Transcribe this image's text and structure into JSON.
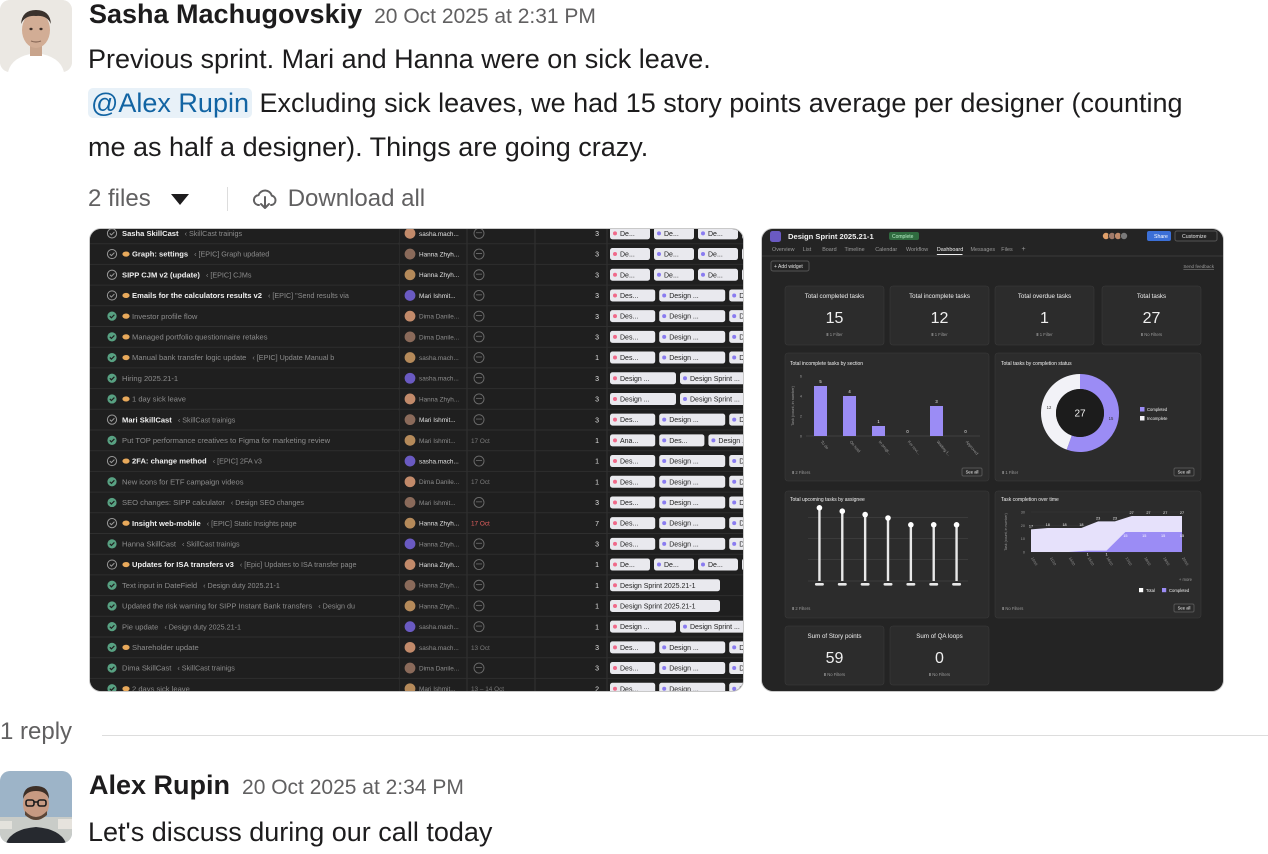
{
  "message1": {
    "author": "Sasha Machugovskiy",
    "timestamp": "20 Oct 2025 at 2:31 PM",
    "line1": "Previous sprint. Mari and Hanna were on sick leave.",
    "mention": "@Alex Rupin",
    "line2_rest": "Excluding sick leaves, we had 15 story points average per designer (counting",
    "line3": "me as half a designer). Things are going crazy."
  },
  "files": {
    "count_label": "2 files",
    "download_label": "Download all"
  },
  "task_list": {
    "rows": [
      {
        "done": false,
        "emoji": false,
        "name": "Sasha SkillCast",
        "parent": "‹ SkillCast trainigs",
        "assignee": "sasha.mach...",
        "due": "",
        "points": "3",
        "tags": [
          "De...",
          "De...",
          "De...",
          "De"
        ],
        "faded": false
      },
      {
        "done": false,
        "emoji": true,
        "name": "Graph: settings",
        "parent": "‹ [EPIC] Graph updated",
        "assignee": "Hanna Zhyh...",
        "due": "",
        "points": "3",
        "tags": [
          "De...",
          "De...",
          "De...",
          "De"
        ],
        "faded": false
      },
      {
        "done": false,
        "emoji": false,
        "name": "SIPP CJM v2 (update)",
        "parent": "‹ [EPIC] CJMs",
        "assignee": "Hanna Zhyh...",
        "due": "",
        "points": "3",
        "tags": [
          "De...",
          "De...",
          "De...",
          "De"
        ],
        "faded": false
      },
      {
        "done": false,
        "emoji": true,
        "name": "Emails for the calculators results v2",
        "parent": "‹ [EPIC] \"Send results via",
        "assignee": "Mari Ishmit...",
        "due": "",
        "points": "3",
        "tags": [
          "Des...",
          "Design ...",
          "De..."
        ],
        "faded": false
      },
      {
        "done": true,
        "emoji": true,
        "name": "Investor profile flow",
        "parent": "",
        "assignee": "Dima Danile...",
        "due": "",
        "points": "3",
        "tags": [
          "Des...",
          "Design ...",
          "De..."
        ],
        "faded": true
      },
      {
        "done": true,
        "emoji": true,
        "name": "Managed portfolio questionnaire retakes",
        "parent": "",
        "assignee": "Dima Danile...",
        "due": "",
        "points": "3",
        "tags": [
          "Des...",
          "Design ...",
          "De..."
        ],
        "faded": true
      },
      {
        "done": true,
        "emoji": true,
        "name": "Manual bank transfer logic update",
        "parent": "‹ [EPIC] Update Manual b",
        "assignee": "sasha.mach...",
        "due": "",
        "points": "1",
        "tags": [
          "Des...",
          "Design ...",
          "De..."
        ],
        "faded": true
      },
      {
        "done": true,
        "emoji": false,
        "name": "Hiring 2025.21-1",
        "parent": "",
        "assignee": "sasha.mach...",
        "due": "",
        "points": "3",
        "tags": [
          "Design ...",
          "Design Sprint ..."
        ],
        "faded": true
      },
      {
        "done": true,
        "emoji": true,
        "name": "1 day sick leave",
        "parent": "",
        "assignee": "Hanna Zhyh...",
        "due": "",
        "points": "3",
        "tags": [
          "Design ...",
          "Design Sprint ..."
        ],
        "faded": true
      },
      {
        "done": false,
        "emoji": false,
        "name": "Mari SkillCast",
        "parent": "‹ SkillCast trainigs",
        "assignee": "Mari Ishmit...",
        "due": "",
        "points": "3",
        "tags": [
          "Des...",
          "Design ...",
          "De..."
        ],
        "faded": false
      },
      {
        "done": true,
        "emoji": false,
        "name": "Put TOP performance creatives to Figma for marketing review",
        "parent": "",
        "assignee": "Mari Ishmit...",
        "due": "17 Oct",
        "points": "1",
        "tags": [
          "Ana...",
          "Des...",
          "Design ..."
        ],
        "faded": true
      },
      {
        "done": false,
        "emoji": true,
        "name": "2FA: change method",
        "parent": "‹ [EPIC] 2FA v3",
        "assignee": "sasha.mach...",
        "due": "",
        "points": "1",
        "tags": [
          "Des...",
          "Design ...",
          "De..."
        ],
        "faded": false
      },
      {
        "done": true,
        "emoji": false,
        "name": "New icons for ETF campaign videos",
        "parent": "",
        "assignee": "Dima Danile...",
        "due": "17 Oct",
        "points": "1",
        "tags": [
          "Des...",
          "Design ...",
          "De..."
        ],
        "faded": true
      },
      {
        "done": true,
        "emoji": false,
        "name": "SEO changes: SIPP calculator",
        "parent": "‹ Design SEO changes",
        "assignee": "Mari Ishmit...",
        "due": "",
        "points": "3",
        "tags": [
          "Des...",
          "Design ...",
          "De..."
        ],
        "faded": true
      },
      {
        "done": false,
        "emoji": true,
        "name": "Insight web-mobile",
        "parent": "‹ [EPIC] Static Insights page",
        "assignee": "Hanna Zhyh...",
        "due": "17 Oct",
        "points": "7",
        "tags": [
          "Des...",
          "Design ...",
          "De..."
        ],
        "faded": false,
        "due_red": true
      },
      {
        "done": true,
        "emoji": false,
        "name": "Hanna SkillCast",
        "parent": "‹ SkillCast trainigs",
        "assignee": "Hanna Zhyh...",
        "due": "",
        "points": "3",
        "tags": [
          "Des...",
          "Design ...",
          "De..."
        ],
        "faded": true
      },
      {
        "done": false,
        "emoji": true,
        "name": "Updates for ISA transfers v3",
        "parent": "‹ [Epic] Updates to ISA transfer page",
        "assignee": "Hanna Zhyh...",
        "due": "",
        "points": "1",
        "tags": [
          "De...",
          "De...",
          "De...",
          "De"
        ],
        "faded": false
      },
      {
        "done": true,
        "emoji": false,
        "name": "Text input in DateField",
        "parent": "‹ Design duty 2025.21-1",
        "assignee": "Hanna Zhyh...",
        "due": "",
        "points": "1",
        "tags": [
          "Design Sprint 2025.21-1"
        ],
        "faded": true
      },
      {
        "done": true,
        "emoji": false,
        "name": "Updated the risk warning for SIPP Instant Bank transfers",
        "parent": "‹ Design du",
        "assignee": "Hanna Zhyh...",
        "due": "",
        "points": "1",
        "tags": [
          "Design Sprint 2025.21-1"
        ],
        "faded": true
      },
      {
        "done": true,
        "emoji": false,
        "name": "Pie update",
        "parent": "‹ Design duty 2025.21-1",
        "assignee": "sasha.mach...",
        "due": "",
        "points": "1",
        "tags": [
          "Design ...",
          "Design Sprint ..."
        ],
        "faded": true
      },
      {
        "done": true,
        "emoji": true,
        "name": "Shareholder update",
        "parent": "",
        "assignee": "sasha.mach...",
        "due": "13 Oct",
        "points": "3",
        "tags": [
          "Des...",
          "Design ...",
          "De..."
        ],
        "faded": true
      },
      {
        "done": true,
        "emoji": false,
        "name": "Dima SkillCast",
        "parent": "‹ SkillCast trainigs",
        "assignee": "Dima Danile...",
        "due": "",
        "points": "3",
        "tags": [
          "Des...",
          "Design ...",
          "De..."
        ],
        "faded": true
      },
      {
        "done": true,
        "emoji": true,
        "name": "2 days sick leave",
        "parent": "",
        "assignee": "Mari Ishmit...",
        "due": "13 – 14 Oct",
        "points": "2",
        "tags": [
          "Des...",
          "Design ...",
          "De..."
        ],
        "faded": true
      }
    ]
  },
  "dashboard": {
    "project_title": "Design Sprint 2025.21-1",
    "status_badge": "Complete",
    "share_label": "Share",
    "customize_label": "Customize",
    "tabs": [
      "Overview",
      "List",
      "Board",
      "Timeline",
      "Calendar",
      "Workflow",
      "Dashboard",
      "Messages",
      "Files"
    ],
    "active_tab": "Dashboard",
    "add_widget_label": "+ Add widget",
    "feedback_label": "Send feedback",
    "stats": [
      {
        "label": "Total completed tasks",
        "value": "15",
        "filter": "1 Filter"
      },
      {
        "label": "Total incomplete tasks",
        "value": "12",
        "filter": "1 Filter"
      },
      {
        "label": "Total overdue tasks",
        "value": "1",
        "filter": "1 Filter"
      },
      {
        "label": "Total tasks",
        "value": "27",
        "filter": "No Filters"
      }
    ],
    "stats_bottom": [
      {
        "label": "Sum of Story points",
        "value": "59",
        "filter": "No Filters"
      },
      {
        "label": "Sum of QA loops",
        "value": "0",
        "filter": "No Filters"
      }
    ],
    "see_all_label": "See all",
    "charts": {
      "by_section": {
        "title": "Total incomplete tasks by section",
        "ylabel": "Task (count, in number)",
        "categories": [
          "To do",
          "On hold",
          "In progr...",
          "For revi...",
          "Waiting f...",
          "Approved"
        ],
        "values": [
          5,
          4,
          1,
          0,
          3,
          0
        ],
        "yticks": [
          "0",
          "2",
          "4",
          "6"
        ],
        "filter": "2 Filters"
      },
      "by_status": {
        "title": "Total tasks by completion status",
        "center": "27",
        "slices": [
          {
            "label": "Completed",
            "value": 15,
            "color": "#9b8cf5"
          },
          {
            "label": "Incomplete",
            "value": 12,
            "color": "#f2f2f7"
          }
        ],
        "filter": "1 Filter"
      },
      "upcoming": {
        "title": "Total upcoming tasks by assignee",
        "values": [
          9,
          8.5,
          8,
          7.5,
          6.5,
          6.5,
          6.5
        ],
        "filter": "2 Filters"
      },
      "completion": {
        "title": "Task completion over time",
        "ylabel": "Task (count, in number)",
        "x": [
          "10/10",
          "11/10",
          "14/10",
          "15/10",
          "16/10",
          "17/10",
          "18/10",
          "19/10",
          "20/10"
        ],
        "total": [
          17,
          18,
          18,
          18,
          23,
          23,
          27,
          27,
          27,
          27
        ],
        "completed": [
          0,
          0,
          0,
          1,
          1,
          15,
          15,
          15,
          15
        ],
        "yticks": [
          "0",
          "10",
          "20",
          "30"
        ],
        "more_label": "+ more",
        "legend_total": "Total",
        "legend_completed": "Completed",
        "filter": "No Filters"
      }
    }
  },
  "replies": {
    "label": "1 reply"
  },
  "message2": {
    "author": "Alex Rupin",
    "timestamp": "20 Oct 2025 at 2:34 PM",
    "text": "Let's discuss during our call today"
  },
  "colors": {
    "mention_bg": "#e8f1f8",
    "mention_text": "#1264a3",
    "accent_purple": "#9b8cf5",
    "dark_bg": "#1f1f1f"
  }
}
